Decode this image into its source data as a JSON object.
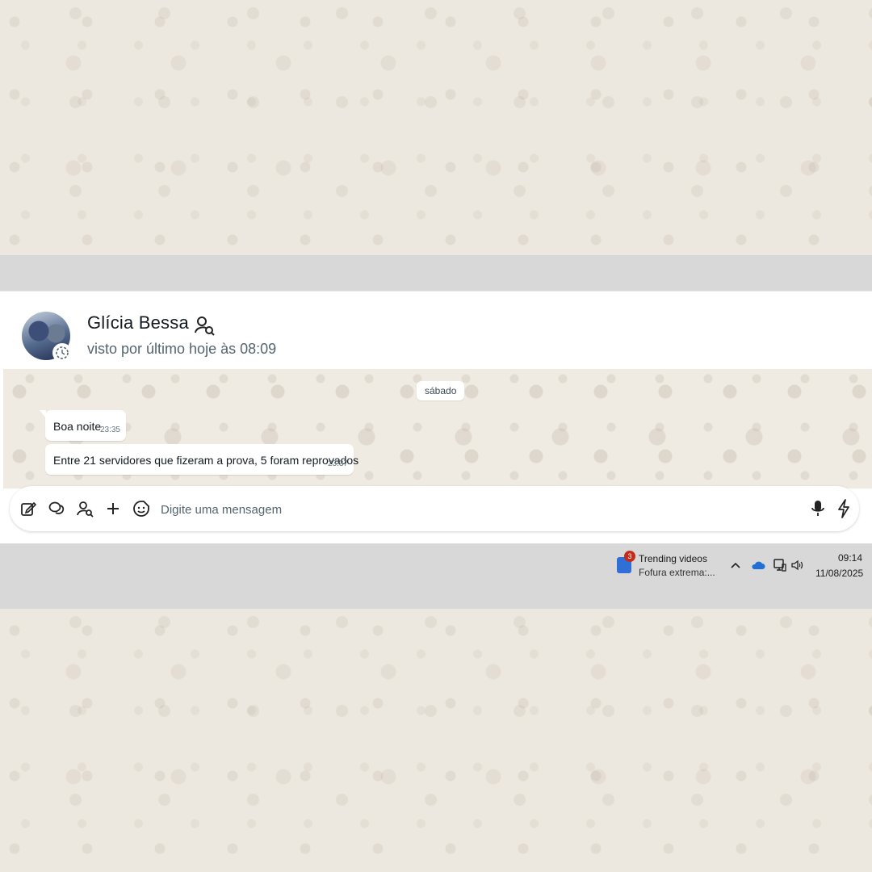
{
  "header": {
    "contact_name": "Glícia Bessa",
    "last_seen": "visto por último hoje às 08:09"
  },
  "chat": {
    "date_separator": "sábado",
    "messages": [
      {
        "text": "Boa noite",
        "time": "23:35"
      },
      {
        "text": "Entre 21 servidores que fizeram a prova, 5 foram reprovados",
        "time": "23:37"
      }
    ]
  },
  "composer": {
    "placeholder": "Digite uma mensagem"
  },
  "taskbar": {
    "news_badge": "3",
    "news_title": "Trending videos",
    "news_subtitle": "Fofura extrema:...",
    "time": "09:14",
    "date": "11/08/2025"
  },
  "icons": {
    "composer": [
      "edit-icon",
      "chat-bubbles-icon",
      "contact-icon",
      "plus-icon",
      "sticker-icon"
    ],
    "right": [
      "microphone-icon",
      "lightning-icon"
    ],
    "tray": [
      "chevron-up-icon",
      "cloud-icon",
      "network-icon",
      "speaker-icon"
    ]
  },
  "colors": {
    "wallpaper": "#efeae2",
    "bubble": "#ffffff",
    "text_primary": "#111b21",
    "text_secondary": "#54656f"
  }
}
